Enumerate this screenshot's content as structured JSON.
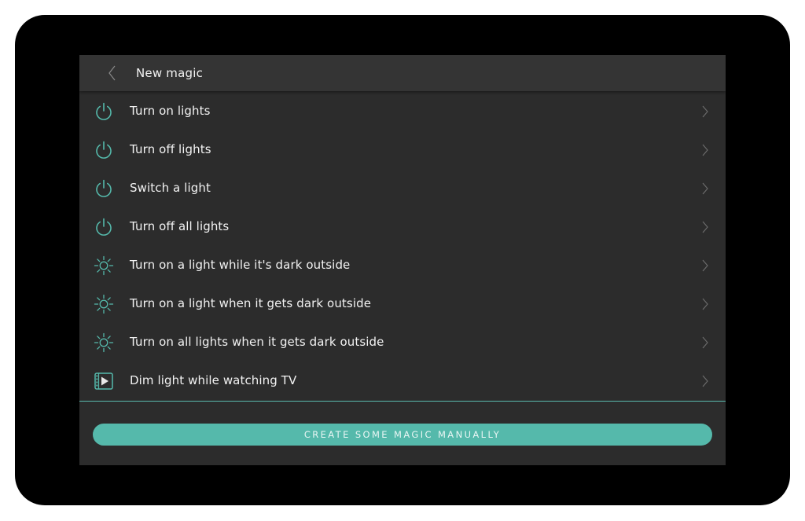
{
  "header": {
    "title": "New magic",
    "back_icon": "chevron-left-icon"
  },
  "items": [
    {
      "label": "Turn on lights",
      "icon": "power-icon"
    },
    {
      "label": "Turn off lights",
      "icon": "power-icon"
    },
    {
      "label": "Switch a light",
      "icon": "power-icon"
    },
    {
      "label": "Turn off all lights",
      "icon": "power-icon"
    },
    {
      "label": "Turn on a light while it's dark outside",
      "icon": "sun-icon"
    },
    {
      "label": "Turn on a light when it gets dark outside",
      "icon": "sun-icon"
    },
    {
      "label": "Turn on all lights when it gets dark outside",
      "icon": "sun-icon"
    },
    {
      "label": "Dim light while watching TV",
      "icon": "play-video-icon"
    }
  ],
  "footer": {
    "button_label": "CREATE SOME MAGIC MANUALLY"
  },
  "colors": {
    "accent": "#55b9ab",
    "background": "#2c2c2c",
    "header_background": "#343434",
    "text": "#f2f2f2"
  }
}
